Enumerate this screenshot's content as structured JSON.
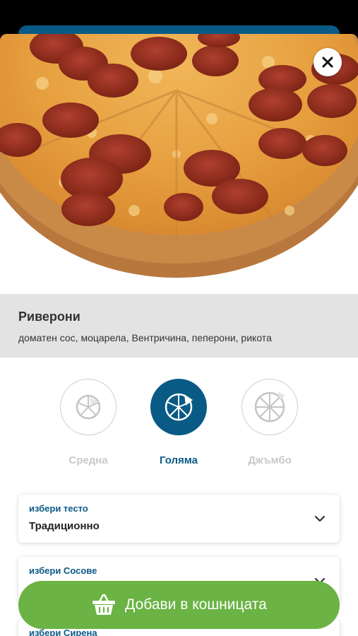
{
  "product": {
    "name": "Риверони",
    "ingredients": "доматен сос, моцарела, Вентричина, пеперони, рикота"
  },
  "sizes": [
    {
      "label": "Средна",
      "icon": "pizza-medium-icon",
      "selected": false
    },
    {
      "label": "Голяма",
      "icon": "pizza-large-icon",
      "selected": true
    },
    {
      "label": "Джъмбо",
      "icon": "pizza-jumbo-icon",
      "selected": false
    }
  ],
  "options": [
    {
      "caption": "избери тесто",
      "value": "Традиционно"
    },
    {
      "caption": "избери Сосове",
      "value": ""
    },
    {
      "caption": "избери Сирена",
      "value": ""
    }
  ],
  "cart_button": {
    "label": "Добави в кошницата",
    "icon": "basket-icon"
  },
  "colors": {
    "brand_blue": "#0a5a86",
    "cart_green": "#6ab344",
    "info_bg": "#e3e3e3"
  }
}
